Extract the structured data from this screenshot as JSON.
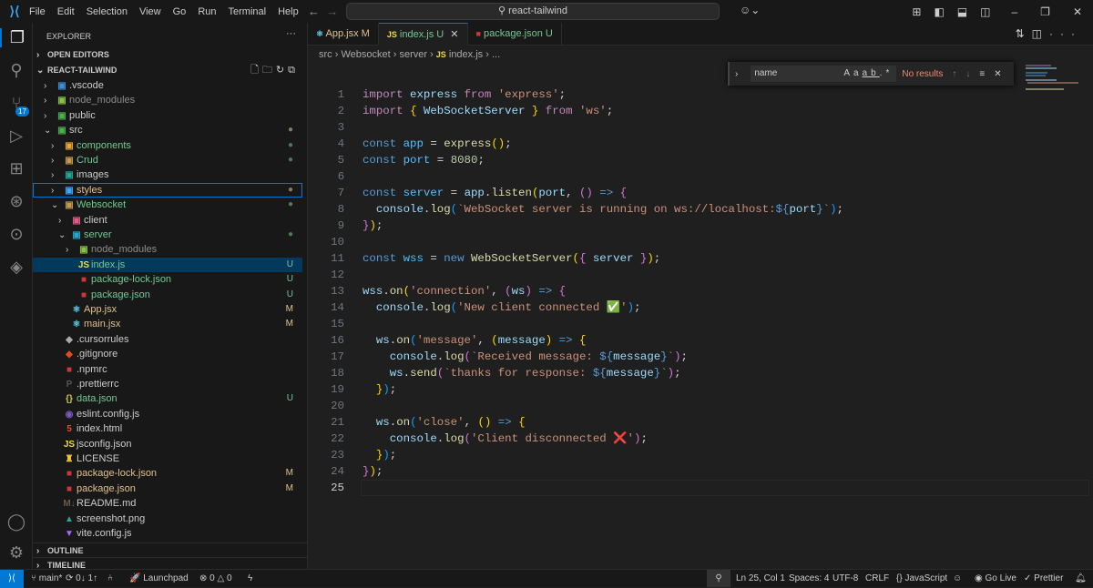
{
  "titlebar": {
    "menu": [
      "File",
      "Edit",
      "Selection",
      "View",
      "Go",
      "Run",
      "Terminal",
      "Help"
    ],
    "search": "react-tailwind"
  },
  "activity": {
    "scm_badge": "17"
  },
  "sidebar": {
    "title": "EXPLORER",
    "open_editors": "OPEN EDITORS",
    "project": "REACT-TAILWIND",
    "outline": "OUTLINE",
    "timeline": "TIMELINE",
    "tree": [
      {
        "label": ".vscode",
        "indent": 0,
        "folder": true,
        "open": false,
        "icon": "▣",
        "icolor": "#3c8fd8",
        "color": "#ccc",
        "badge": ""
      },
      {
        "label": "node_modules",
        "indent": 0,
        "folder": true,
        "open": false,
        "icon": "▣",
        "icolor": "#8bc34a",
        "color": "#8c8c8c",
        "badge": ""
      },
      {
        "label": "public",
        "indent": 0,
        "folder": true,
        "open": false,
        "icon": "▣",
        "icolor": "#4caf50",
        "color": "#ccc",
        "badge": ""
      },
      {
        "label": "src",
        "indent": 0,
        "folder": true,
        "open": true,
        "icon": "▣",
        "icolor": "#4caf50",
        "color": "#ccc",
        "badge": "●",
        "bcolor": "#8d7a5e"
      },
      {
        "label": "components",
        "indent": 1,
        "folder": true,
        "open": false,
        "icon": "▣",
        "icolor": "#e8a63a",
        "color": "#73c991",
        "badge": "●",
        "bcolor": "#4d7a5a"
      },
      {
        "label": "Crud",
        "indent": 1,
        "folder": true,
        "open": false,
        "icon": "▣",
        "icolor": "#c49a52",
        "color": "#73c991",
        "badge": "●",
        "bcolor": "#4d7a5a"
      },
      {
        "label": "images",
        "indent": 1,
        "folder": true,
        "open": false,
        "icon": "▣",
        "icolor": "#26a69a",
        "color": "#ccc",
        "badge": ""
      },
      {
        "label": "styles",
        "indent": 1,
        "folder": true,
        "open": false,
        "icon": "▣",
        "icolor": "#42a5f5",
        "color": "#e2c08d",
        "badge": "●",
        "bcolor": "#8d7a5e",
        "focus": true
      },
      {
        "label": "Websocket",
        "indent": 1,
        "folder": true,
        "open": true,
        "icon": "▣",
        "icolor": "#c49a52",
        "color": "#73c991",
        "badge": "●",
        "bcolor": "#4d7a5a"
      },
      {
        "label": "client",
        "indent": 2,
        "folder": true,
        "open": false,
        "icon": "▣",
        "icolor": "#e05a8a",
        "color": "#ccc",
        "badge": ""
      },
      {
        "label": "server",
        "indent": 2,
        "folder": true,
        "open": true,
        "icon": "▣",
        "icolor": "#26a6c8",
        "color": "#73c991",
        "badge": "●",
        "bcolor": "#4d7a5a"
      },
      {
        "label": "node_modules",
        "indent": 3,
        "folder": true,
        "open": false,
        "icon": "▣",
        "icolor": "#8bc34a",
        "color": "#8c8c8c",
        "badge": ""
      },
      {
        "label": "index.js",
        "indent": 3,
        "folder": false,
        "icon": "JS",
        "icolor": "#f1dd3f",
        "color": "#73c991",
        "badge": "U",
        "bcolor": "#73c991",
        "selected": true
      },
      {
        "label": "package-lock.json",
        "indent": 3,
        "folder": false,
        "icon": "■",
        "icolor": "#cb3837",
        "color": "#73c991",
        "badge": "U",
        "bcolor": "#73c991"
      },
      {
        "label": "package.json",
        "indent": 3,
        "folder": false,
        "icon": "■",
        "icolor": "#cb3837",
        "color": "#73c991",
        "badge": "U",
        "bcolor": "#73c991"
      },
      {
        "label": "App.jsx",
        "indent": 2,
        "folder": false,
        "icon": "⚛",
        "icolor": "#5fd4f4",
        "color": "#e2c08d",
        "badge": "M",
        "bcolor": "#e2c08d"
      },
      {
        "label": "main.jsx",
        "indent": 2,
        "folder": false,
        "icon": "⚛",
        "icolor": "#5fd4f4",
        "color": "#e2c08d",
        "badge": "M",
        "bcolor": "#e2c08d"
      },
      {
        "label": ".cursorrules",
        "indent": 1,
        "folder": false,
        "icon": "◆",
        "icolor": "#aaa",
        "color": "#ccc",
        "badge": ""
      },
      {
        "label": ".gitignore",
        "indent": 1,
        "folder": false,
        "icon": "◆",
        "icolor": "#e64a19",
        "color": "#ccc",
        "badge": ""
      },
      {
        "label": ".npmrc",
        "indent": 1,
        "folder": false,
        "icon": "■",
        "icolor": "#cb3837",
        "color": "#ccc",
        "badge": ""
      },
      {
        "label": ".prettierrc",
        "indent": 1,
        "folder": false,
        "icon": "P",
        "icolor": "#555",
        "color": "#ccc",
        "badge": ""
      },
      {
        "label": "data.json",
        "indent": 1,
        "folder": false,
        "icon": "{}",
        "icolor": "#cbcb41",
        "color": "#73c991",
        "badge": "U",
        "bcolor": "#73c991"
      },
      {
        "label": "eslint.config.js",
        "indent": 1,
        "folder": false,
        "icon": "◉",
        "icolor": "#7e57c2",
        "color": "#ccc",
        "badge": ""
      },
      {
        "label": "index.html",
        "indent": 1,
        "folder": false,
        "icon": "5",
        "icolor": "#e44d26",
        "color": "#ccc",
        "badge": ""
      },
      {
        "label": "jsconfig.json",
        "indent": 1,
        "folder": false,
        "icon": "JS",
        "icolor": "#f1dd3f",
        "color": "#ccc",
        "badge": ""
      },
      {
        "label": "LICENSE",
        "indent": 1,
        "folder": false,
        "icon": "♜",
        "icolor": "#f1c232",
        "color": "#ccc",
        "badge": ""
      },
      {
        "label": "package-lock.json",
        "indent": 1,
        "folder": false,
        "icon": "■",
        "icolor": "#cb3837",
        "color": "#e2c08d",
        "badge": "M",
        "bcolor": "#e2c08d"
      },
      {
        "label": "package.json",
        "indent": 1,
        "folder": false,
        "icon": "■",
        "icolor": "#cb3837",
        "color": "#e2c08d",
        "badge": "M",
        "bcolor": "#e2c08d"
      },
      {
        "label": "README.md",
        "indent": 1,
        "folder": false,
        "icon": "M↓",
        "icolor": "#6b5a4a",
        "color": "#ccc",
        "badge": ""
      },
      {
        "label": "screenshot.png",
        "indent": 1,
        "folder": false,
        "icon": "▲",
        "icolor": "#26a69a",
        "color": "#ccc",
        "badge": ""
      },
      {
        "label": "vite.config.js",
        "indent": 1,
        "folder": false,
        "icon": "▼",
        "icolor": "#a66bff",
        "color": "#ccc",
        "badge": ""
      }
    ]
  },
  "tabs": [
    {
      "label": "App.jsx",
      "status": "M",
      "icon": "⚛",
      "icolor": "#5fd4f4",
      "color": "#e2c08d"
    },
    {
      "label": "index.js",
      "status": "U",
      "icon": "JS",
      "icolor": "#f1dd3f",
      "color": "#73c991",
      "active": true
    },
    {
      "label": "package.json",
      "status": "U",
      "icon": "■",
      "icolor": "#cb3837",
      "color": "#73c991"
    }
  ],
  "breadcrumb": [
    "src",
    "Websocket",
    "server",
    "index.js",
    "..."
  ],
  "find": {
    "value": "name",
    "case": "Aa",
    "word": "ab",
    "regex": ".*",
    "result": "No results"
  },
  "code": {
    "current_line": 25,
    "lines": [
      [
        [
          "import",
          "kw"
        ],
        [
          " express ",
          "v"
        ],
        [
          "from",
          "kw"
        ],
        [
          " ",
          "p"
        ],
        [
          "'express'",
          "s"
        ],
        [
          ";",
          "p"
        ]
      ],
      [
        [
          "import",
          "kw"
        ],
        [
          " ",
          "p"
        ],
        [
          "{",
          "b1"
        ],
        [
          " WebSocketServer ",
          "v"
        ],
        [
          "}",
          "b1"
        ],
        [
          " ",
          "p"
        ],
        [
          "from",
          "kw"
        ],
        [
          " ",
          "p"
        ],
        [
          "'ws'",
          "s"
        ],
        [
          ";",
          "p"
        ]
      ],
      [],
      [
        [
          "const",
          "st"
        ],
        [
          " app",
          "c"
        ],
        [
          " = ",
          "p"
        ],
        [
          "express",
          "fn"
        ],
        [
          "()",
          "b1"
        ],
        [
          ";",
          "p"
        ]
      ],
      [
        [
          "const",
          "st"
        ],
        [
          " port",
          "c"
        ],
        [
          " = ",
          "p"
        ],
        [
          "8080",
          "n"
        ],
        [
          ";",
          "p"
        ]
      ],
      [],
      [
        [
          "const",
          "st"
        ],
        [
          " server",
          "c"
        ],
        [
          " = ",
          "p"
        ],
        [
          "app",
          "v"
        ],
        [
          ".",
          "p"
        ],
        [
          "listen",
          "fn"
        ],
        [
          "(",
          "b1"
        ],
        [
          "port",
          "v"
        ],
        [
          ", ",
          "p"
        ],
        [
          "()",
          "b2"
        ],
        [
          " => ",
          "st"
        ],
        [
          "{",
          "b2"
        ]
      ],
      [
        [
          "  console",
          "v"
        ],
        [
          ".",
          "p"
        ],
        [
          "log",
          "fn"
        ],
        [
          "(",
          "b3"
        ],
        [
          "`WebSocket server is running on ws://localhost:",
          "s"
        ],
        [
          "${",
          "st"
        ],
        [
          "port",
          "v"
        ],
        [
          "}",
          "st"
        ],
        [
          "`",
          "s"
        ],
        [
          ")",
          "b3"
        ],
        [
          ";",
          "p"
        ]
      ],
      [
        [
          "}",
          "b2"
        ],
        [
          ")",
          "b1"
        ],
        [
          ";",
          "p"
        ]
      ],
      [],
      [
        [
          "const",
          "st"
        ],
        [
          " wss",
          "c"
        ],
        [
          " = ",
          "p"
        ],
        [
          "new",
          "st"
        ],
        [
          " ",
          "p"
        ],
        [
          "WebSocketServer",
          "fn"
        ],
        [
          "(",
          "b1"
        ],
        [
          "{",
          "b2"
        ],
        [
          " server ",
          "v"
        ],
        [
          "}",
          "b2"
        ],
        [
          ")",
          "b1"
        ],
        [
          ";",
          "p"
        ]
      ],
      [],
      [
        [
          "wss",
          "v"
        ],
        [
          ".",
          "p"
        ],
        [
          "on",
          "fn"
        ],
        [
          "(",
          "b1"
        ],
        [
          "'connection'",
          "s"
        ],
        [
          ", ",
          "p"
        ],
        [
          "(",
          "b2"
        ],
        [
          "ws",
          "v"
        ],
        [
          ")",
          "b2"
        ],
        [
          " => ",
          "st"
        ],
        [
          "{",
          "b2"
        ]
      ],
      [
        [
          "  console",
          "v"
        ],
        [
          ".",
          "p"
        ],
        [
          "log",
          "fn"
        ],
        [
          "(",
          "b3"
        ],
        [
          "'New client connected ✅'",
          "s"
        ],
        [
          ")",
          "b3"
        ],
        [
          ";",
          "p"
        ]
      ],
      [],
      [
        [
          "  ws",
          "v"
        ],
        [
          ".",
          "p"
        ],
        [
          "on",
          "fn"
        ],
        [
          "(",
          "b3"
        ],
        [
          "'message'",
          "s"
        ],
        [
          ", ",
          "p"
        ],
        [
          "(",
          "b1"
        ],
        [
          "message",
          "v"
        ],
        [
          ")",
          "b1"
        ],
        [
          " => ",
          "st"
        ],
        [
          "{",
          "b1"
        ]
      ],
      [
        [
          "    console",
          "v"
        ],
        [
          ".",
          "p"
        ],
        [
          "log",
          "fn"
        ],
        [
          "(",
          "b2"
        ],
        [
          "`Received message: ",
          "s"
        ],
        [
          "${",
          "st"
        ],
        [
          "message",
          "v"
        ],
        [
          "}",
          "st"
        ],
        [
          "`",
          "s"
        ],
        [
          ")",
          "b2"
        ],
        [
          ";",
          "p"
        ]
      ],
      [
        [
          "    ws",
          "v"
        ],
        [
          ".",
          "p"
        ],
        [
          "send",
          "fn"
        ],
        [
          "(",
          "b2"
        ],
        [
          "`thanks for response: ",
          "s"
        ],
        [
          "${",
          "st"
        ],
        [
          "message",
          "v"
        ],
        [
          "}",
          "st"
        ],
        [
          "`",
          "s"
        ],
        [
          ")",
          "b2"
        ],
        [
          ";",
          "p"
        ]
      ],
      [
        [
          "  }",
          "b1"
        ],
        [
          ")",
          "b3"
        ],
        [
          ";",
          "p"
        ]
      ],
      [],
      [
        [
          "  ws",
          "v"
        ],
        [
          ".",
          "p"
        ],
        [
          "on",
          "fn"
        ],
        [
          "(",
          "b3"
        ],
        [
          "'close'",
          "s"
        ],
        [
          ", ",
          "p"
        ],
        [
          "()",
          "b1"
        ],
        [
          " => ",
          "st"
        ],
        [
          "{",
          "b1"
        ]
      ],
      [
        [
          "    console",
          "v"
        ],
        [
          ".",
          "p"
        ],
        [
          "log",
          "fn"
        ],
        [
          "(",
          "b2"
        ],
        [
          "'Client disconnected ❌'",
          "s"
        ],
        [
          ")",
          "b2"
        ],
        [
          ";",
          "p"
        ]
      ],
      [
        [
          "  }",
          "b1"
        ],
        [
          ")",
          "b3"
        ],
        [
          ";",
          "p"
        ]
      ],
      [
        [
          "}",
          "b2"
        ],
        [
          ")",
          "b1"
        ],
        [
          ";",
          "p"
        ]
      ],
      []
    ]
  },
  "status": {
    "branch": "main*",
    "sync": "0↓ 1↑",
    "launchpad": "Launchpad",
    "errors": "0",
    "warnings": "0",
    "position": "Ln 25, Col 1",
    "spaces": "Spaces: 4",
    "encoding": "UTF-8",
    "eol": "CRLF",
    "language": "JavaScript",
    "golive": "Go Live",
    "prettier": "Prettier"
  }
}
